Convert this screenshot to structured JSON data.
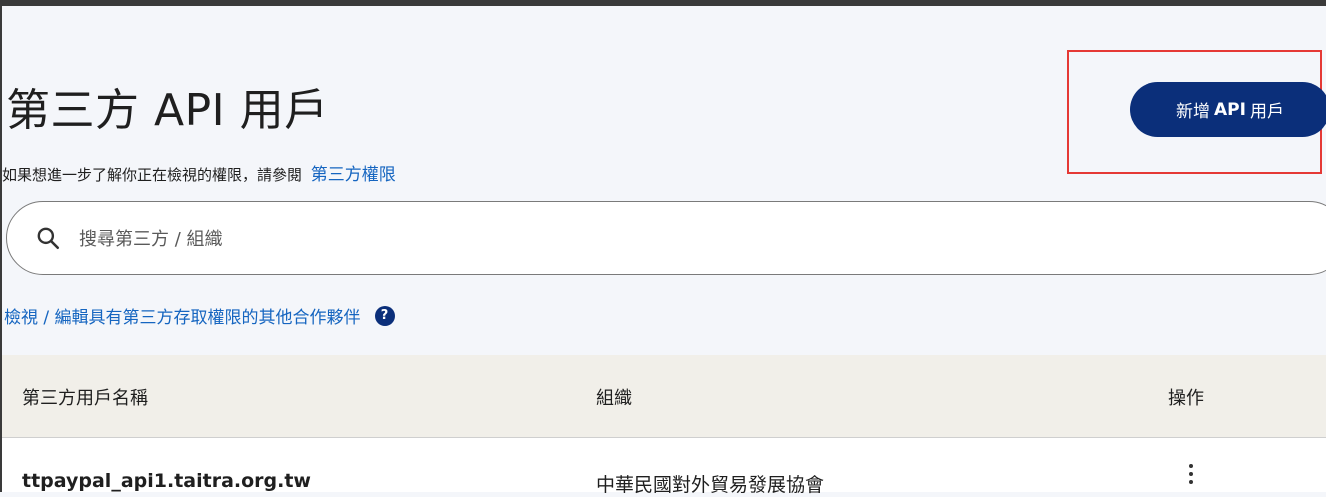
{
  "header": {
    "title": "第三方 API 用戶",
    "subtitle_text": "如果想進一步了解你正在檢視的權限，請參閱",
    "subtitle_link": "第三方權限",
    "add_button": {
      "prefix": "新增",
      "bold": "API",
      "suffix": "用戶"
    }
  },
  "search": {
    "placeholder": "搜尋第三方 / 組織",
    "icon": "search-icon"
  },
  "partner_link": {
    "label": "檢視 / 編輯具有第三方存取權限的其他合作夥伴",
    "help_icon": "question-circle-icon",
    "help_glyph": "?"
  },
  "table": {
    "columns": [
      "第三方用戶名稱",
      "組織",
      "操作"
    ],
    "rows": [
      {
        "name": "ttpaypal_api1.taitra.org.tw",
        "organization": "中華民國對外貿易發展協會",
        "action_icon": "more-vertical-icon"
      }
    ]
  },
  "colors": {
    "primary": "#0b2f7a",
    "link": "#1565c0",
    "highlight": "#e53935",
    "header_bg": "#f1efe9",
    "page_bg": "#f4f6fa"
  }
}
